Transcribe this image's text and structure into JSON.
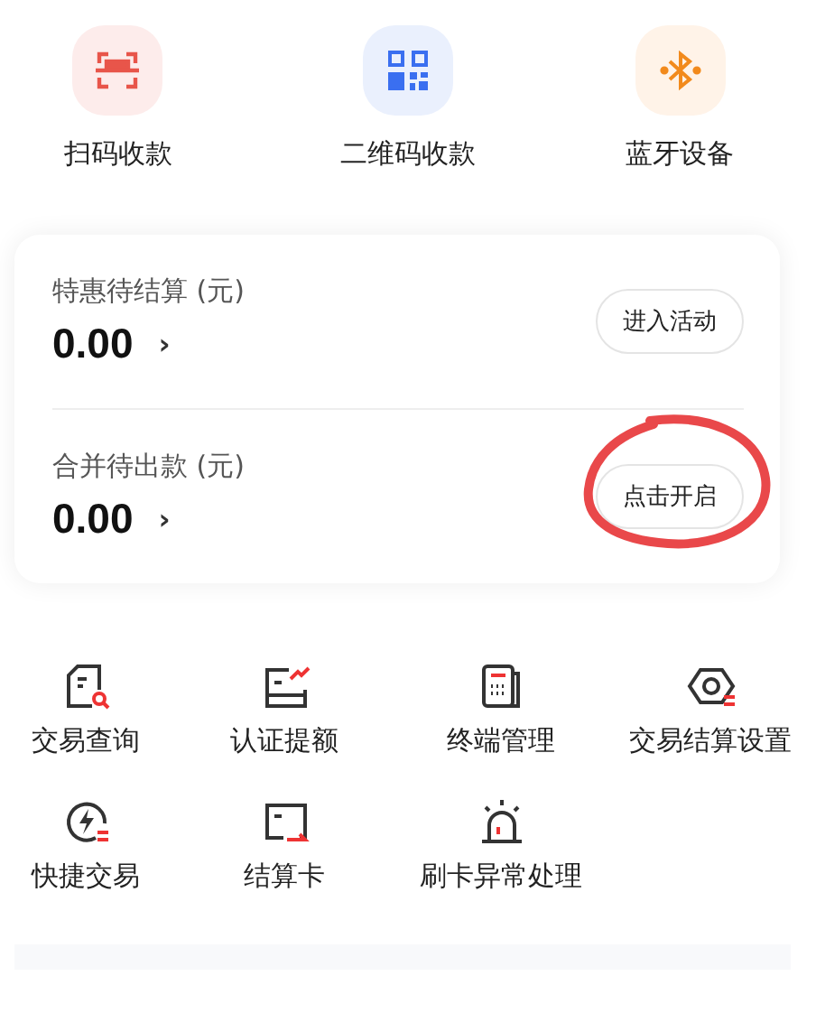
{
  "quick_actions": [
    {
      "kind": "scan",
      "label": "扫码收款"
    },
    {
      "kind": "qr",
      "label": "二维码收款"
    },
    {
      "kind": "bluetooth",
      "label": "蓝牙设备"
    }
  ],
  "balances": [
    {
      "title": "特惠待结算 (元)",
      "amount": "0.00",
      "chevron": "›",
      "button": "进入活动",
      "circled": false
    },
    {
      "title": "合并待出款 (元)",
      "amount": "0.00",
      "chevron": "›",
      "button": "点击开启",
      "circled": true
    }
  ],
  "services": [
    {
      "kind": "query",
      "label": "交易查询"
    },
    {
      "kind": "limit",
      "label": "认证提额"
    },
    {
      "kind": "terminal",
      "label": "终端管理"
    },
    {
      "kind": "settle_settings",
      "label": "交易结算设置"
    },
    {
      "kind": "quick",
      "label": "快捷交易"
    },
    {
      "kind": "card",
      "label": "结算卡"
    },
    {
      "kind": "alarm",
      "label": "刷卡异常处理"
    }
  ]
}
